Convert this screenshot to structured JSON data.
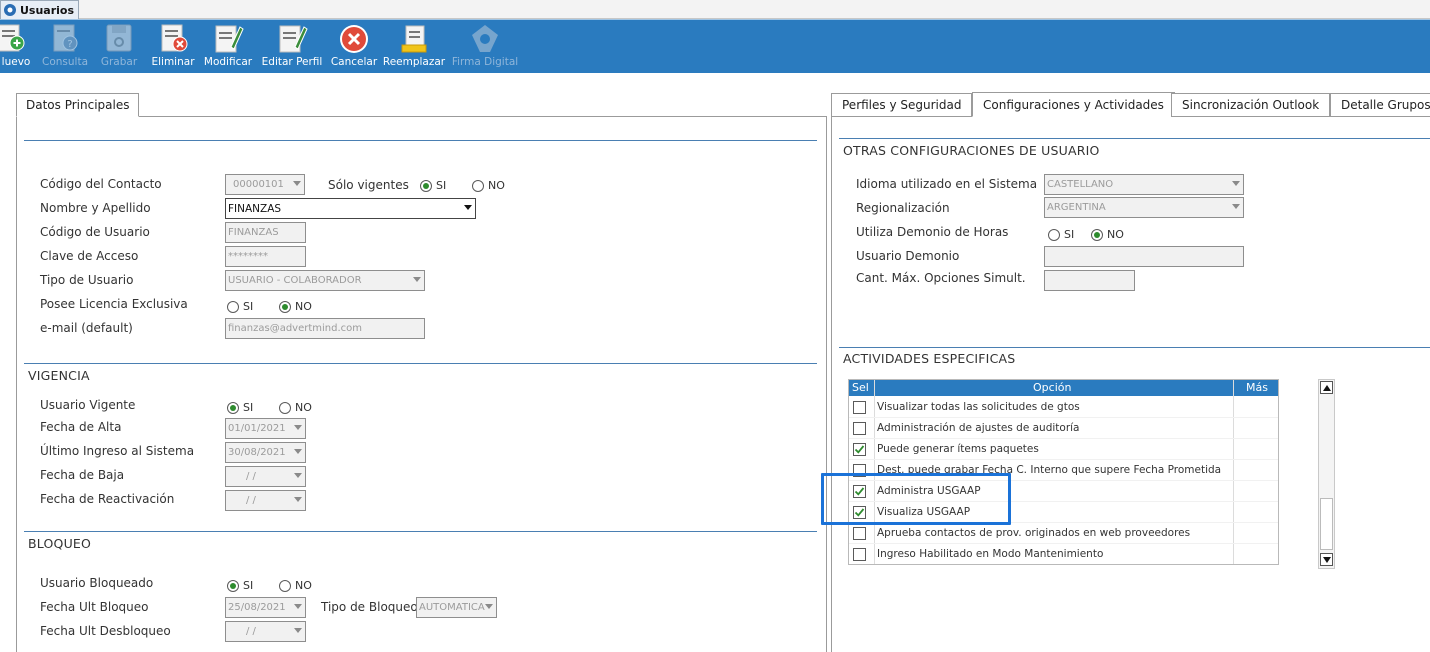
{
  "window_tab": {
    "title": "Usuarios"
  },
  "toolbar": {
    "buttons": [
      {
        "label": "Nuevo",
        "display": "luevo",
        "icon": "new-icon",
        "enabled": true
      },
      {
        "label": "Consulta",
        "icon": "query-icon",
        "enabled": false
      },
      {
        "label": "Grabar",
        "icon": "save-icon",
        "enabled": false
      },
      {
        "label": "Eliminar",
        "icon": "delete-icon",
        "enabled": true
      },
      {
        "label": "Modificar",
        "icon": "edit-icon",
        "enabled": true
      },
      {
        "label": "Editar Perfil",
        "icon": "edit-profile-icon",
        "enabled": true
      },
      {
        "label": "Cancelar",
        "icon": "cancel-icon",
        "enabled": true
      },
      {
        "label": "Reemplazar",
        "icon": "replace-icon",
        "enabled": true
      },
      {
        "label": "Firma Digital",
        "icon": "digital-signature-icon",
        "enabled": false
      }
    ]
  },
  "left_tab": {
    "label": "Datos Principales"
  },
  "datos": {
    "codigo_contacto": {
      "label": "Código del Contacto",
      "value": "00000101"
    },
    "solo_vigentes": {
      "label": "Sólo vigentes",
      "si": "SI",
      "no": "NO",
      "selected": "SI"
    },
    "nombre": {
      "label": "Nombre y Apellido",
      "value": "FINANZAS"
    },
    "codigo_usuario": {
      "label": "Código de Usuario",
      "value": "FINANZAS"
    },
    "clave": {
      "label": "Clave de Acceso",
      "value": "********"
    },
    "tipo_usuario": {
      "label": "Tipo de Usuario",
      "value": "USUARIO - COLABORADOR"
    },
    "licencia": {
      "label": "Posee Licencia Exclusiva",
      "si": "SI",
      "no": "NO",
      "selected": "NO"
    },
    "email": {
      "label": "e-mail (default)",
      "value": "finanzas@advertmind.com"
    }
  },
  "vigencia": {
    "title": "VIGENCIA",
    "usuario_vigente": {
      "label": "Usuario Vigente",
      "si": "SI",
      "no": "NO",
      "selected": "SI"
    },
    "fecha_alta": {
      "label": "Fecha de Alta",
      "value": "01/01/2021"
    },
    "ultimo_ingreso": {
      "label": "Último Ingreso al Sistema",
      "value": "30/08/2021"
    },
    "fecha_baja": {
      "label": "Fecha de Baja",
      "value": "/ /"
    },
    "fecha_reactivacion": {
      "label": "Fecha de Reactivación",
      "value": "/ /"
    }
  },
  "bloqueo": {
    "title": "BLOQUEO",
    "usuario_bloqueado": {
      "label": "Usuario Bloqueado",
      "si": "SI",
      "no": "NO",
      "selected": "SI"
    },
    "fecha_ult_bloqueo": {
      "label": "Fecha Ult Bloqueo",
      "value": "25/08/2021"
    },
    "tipo_bloqueo": {
      "label": "Tipo de Bloqueo",
      "value": "AUTOMATICA"
    },
    "fecha_ult_desbloqueo": {
      "label": "Fecha Ult Desbloqueo",
      "value": "/ /"
    }
  },
  "right_tabs": [
    {
      "label": "Perfiles y Seguridad",
      "active": false
    },
    {
      "label": "Configuraciones y Actividades",
      "active": true
    },
    {
      "label": "Sincronización Outlook",
      "active": false
    },
    {
      "label": "Detalle Grupos",
      "active": false
    }
  ],
  "otras": {
    "title": "OTRAS CONFIGURACIONES DE USUARIO",
    "idioma": {
      "label": "Idioma utilizado en el Sistema",
      "value": "CASTELLANO"
    },
    "regionalizacion": {
      "label": "Regionalización",
      "value": "ARGENTINA"
    },
    "demonio_horas": {
      "label": "Utiliza Demonio de Horas",
      "si": "SI",
      "no": "NO",
      "selected": "NO"
    },
    "usuario_demonio": {
      "label": "Usuario Demonio",
      "value": ""
    },
    "cant_max": {
      "label": "Cant. Máx. Opciones Simult.",
      "value": ""
    }
  },
  "actividades": {
    "title": "ACTIVIDADES ESPECIFICAS",
    "columns": {
      "sel": "Sel",
      "opcion": "Opción",
      "mas": "Más"
    },
    "rows": [
      {
        "text": "Visualizar todas las solicitudes de gtos",
        "checked": false
      },
      {
        "text": "Administración de ajustes de auditoría",
        "checked": false
      },
      {
        "text": "Puede generar ítems paquetes",
        "checked": true
      },
      {
        "text": "Dest. puede grabar Fecha C. Interno que supere Fecha Prometida",
        "checked": false
      },
      {
        "text": "Administra USGAAP",
        "checked": true
      },
      {
        "text": "Visualiza USGAAP",
        "checked": true
      },
      {
        "text": "Aprueba contactos de prov. originados en web proveedores",
        "checked": false
      },
      {
        "text": "Ingreso Habilitado en Modo Mantenimiento",
        "checked": false
      }
    ]
  },
  "colors": {
    "toolbar_bg": "#2a7bbf",
    "section_line": "#4a7fb2",
    "highlight": "#1a72d8",
    "radio_selected": "#2e8b2e"
  }
}
